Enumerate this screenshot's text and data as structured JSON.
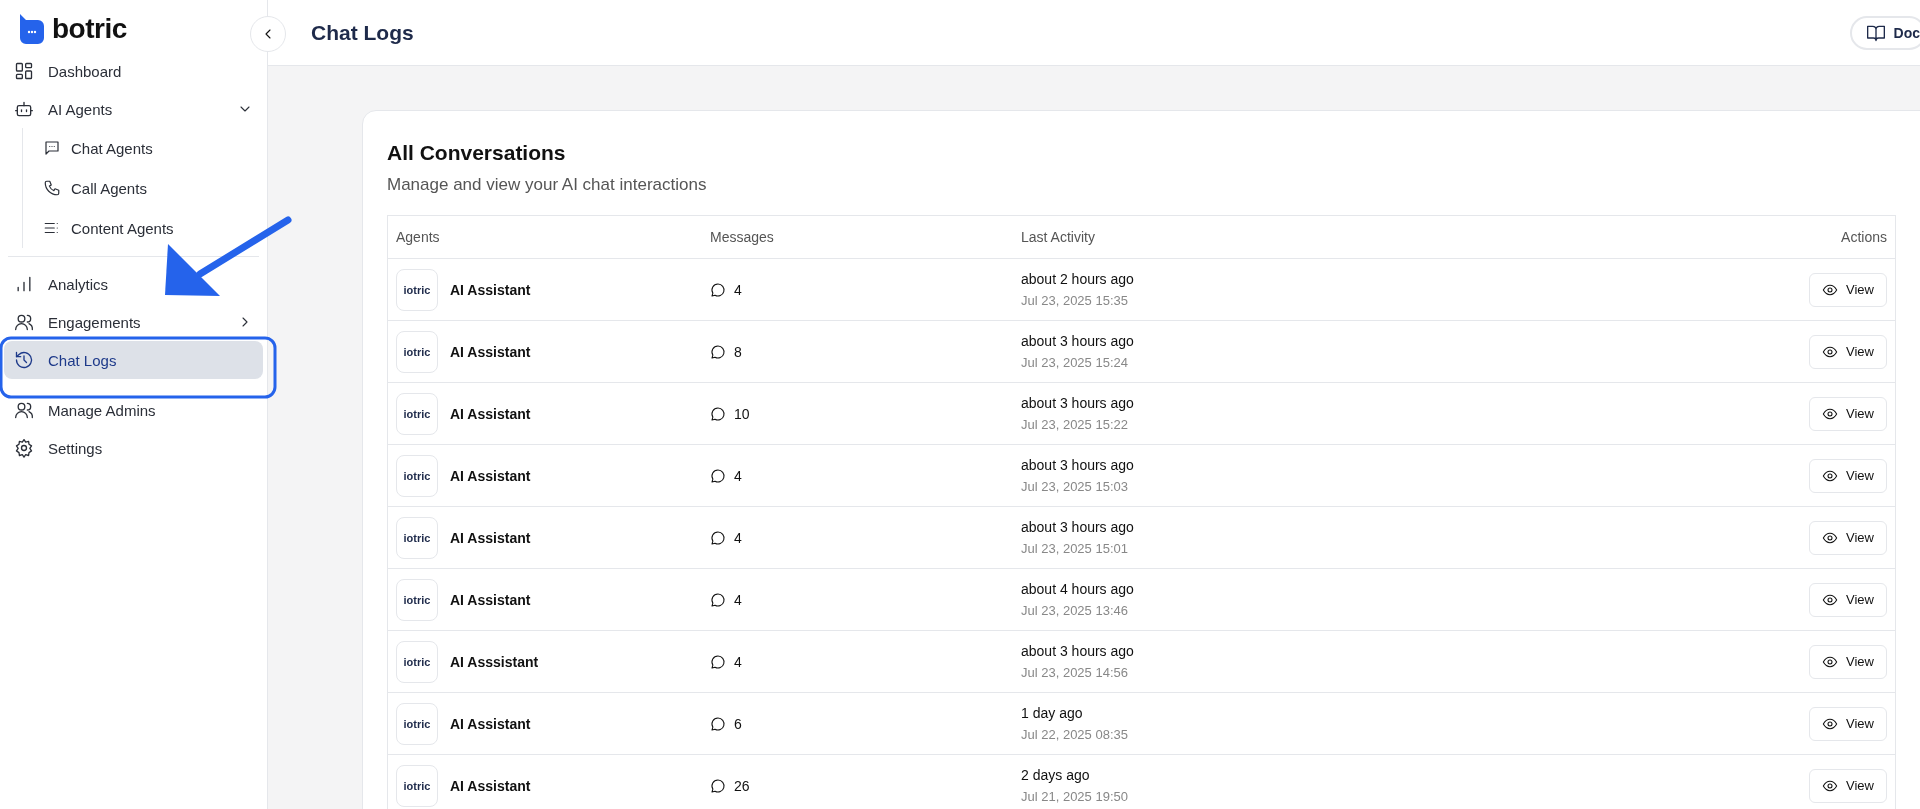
{
  "brand": {
    "name": "botric"
  },
  "sidebar": {
    "items": [
      {
        "label": "Dashboard",
        "kind": "grid",
        "selected": false
      },
      {
        "label": "AI Agents",
        "kind": "robot",
        "selected": false,
        "expanded": true,
        "children": [
          {
            "label": "Chat Agents",
            "kind": "chat",
            "selected": false
          },
          {
            "label": "Call Agents",
            "kind": "phone",
            "selected": false
          },
          {
            "label": "Content Agents",
            "kind": "list",
            "selected": false
          }
        ]
      },
      {
        "label": "Analytics",
        "kind": "bars",
        "selected": false,
        "divider_before": true
      },
      {
        "label": "Engagements",
        "kind": "users",
        "selected": false,
        "expanded": false
      },
      {
        "label": "Chat Logs",
        "kind": "history",
        "selected": true
      },
      {
        "label": "Manage Admins",
        "kind": "users",
        "selected": false
      },
      {
        "label": "Settings",
        "kind": "gear",
        "selected": false
      }
    ]
  },
  "header": {
    "title": "Chat Logs",
    "docs_button": "Doc"
  },
  "card": {
    "title": "All Conversations",
    "subtitle": "Manage and view your AI chat interactions"
  },
  "table": {
    "columns": [
      "Agents",
      "Messages",
      "Last Activity",
      "Actions"
    ],
    "rows": [
      {
        "logo": "iotric",
        "agent": "AI Assistant",
        "messages": "4",
        "relative": "about 2 hours ago",
        "date": "Jul 23, 2025 15:35",
        "action": "View"
      },
      {
        "logo": "iotric",
        "agent": "AI Assistant",
        "messages": "8",
        "relative": "about 3 hours ago",
        "date": "Jul 23, 2025 15:24",
        "action": "View"
      },
      {
        "logo": "iotric",
        "agent": "AI Assistant",
        "messages": "10",
        "relative": "about 3 hours ago",
        "date": "Jul 23, 2025 15:22",
        "action": "View"
      },
      {
        "logo": "iotric",
        "agent": "AI Assistant",
        "messages": "4",
        "relative": "about 3 hours ago",
        "date": "Jul 23, 2025 15:03",
        "action": "View"
      },
      {
        "logo": "iotric",
        "agent": "AI Assistant",
        "messages": "4",
        "relative": "about 3 hours ago",
        "date": "Jul 23, 2025 15:01",
        "action": "View"
      },
      {
        "logo": "iotric",
        "agent": "AI Assistant",
        "messages": "4",
        "relative": "about 4 hours ago",
        "date": "Jul 23, 2025 13:46",
        "action": "View"
      },
      {
        "logo": "iotric",
        "agent": "AI Asssistant",
        "messages": "4",
        "relative": "about 3 hours ago",
        "date": "Jul 23, 2025 14:56",
        "action": "View"
      },
      {
        "logo": "iotric",
        "agent": "AI Assistant",
        "messages": "6",
        "relative": "1 day ago",
        "date": "Jul 22, 2025 08:35",
        "action": "View"
      },
      {
        "logo": "iotric",
        "agent": "AI Assistant",
        "messages": "26",
        "relative": "2 days ago",
        "date": "Jul 21, 2025 19:50",
        "action": "View"
      }
    ]
  }
}
